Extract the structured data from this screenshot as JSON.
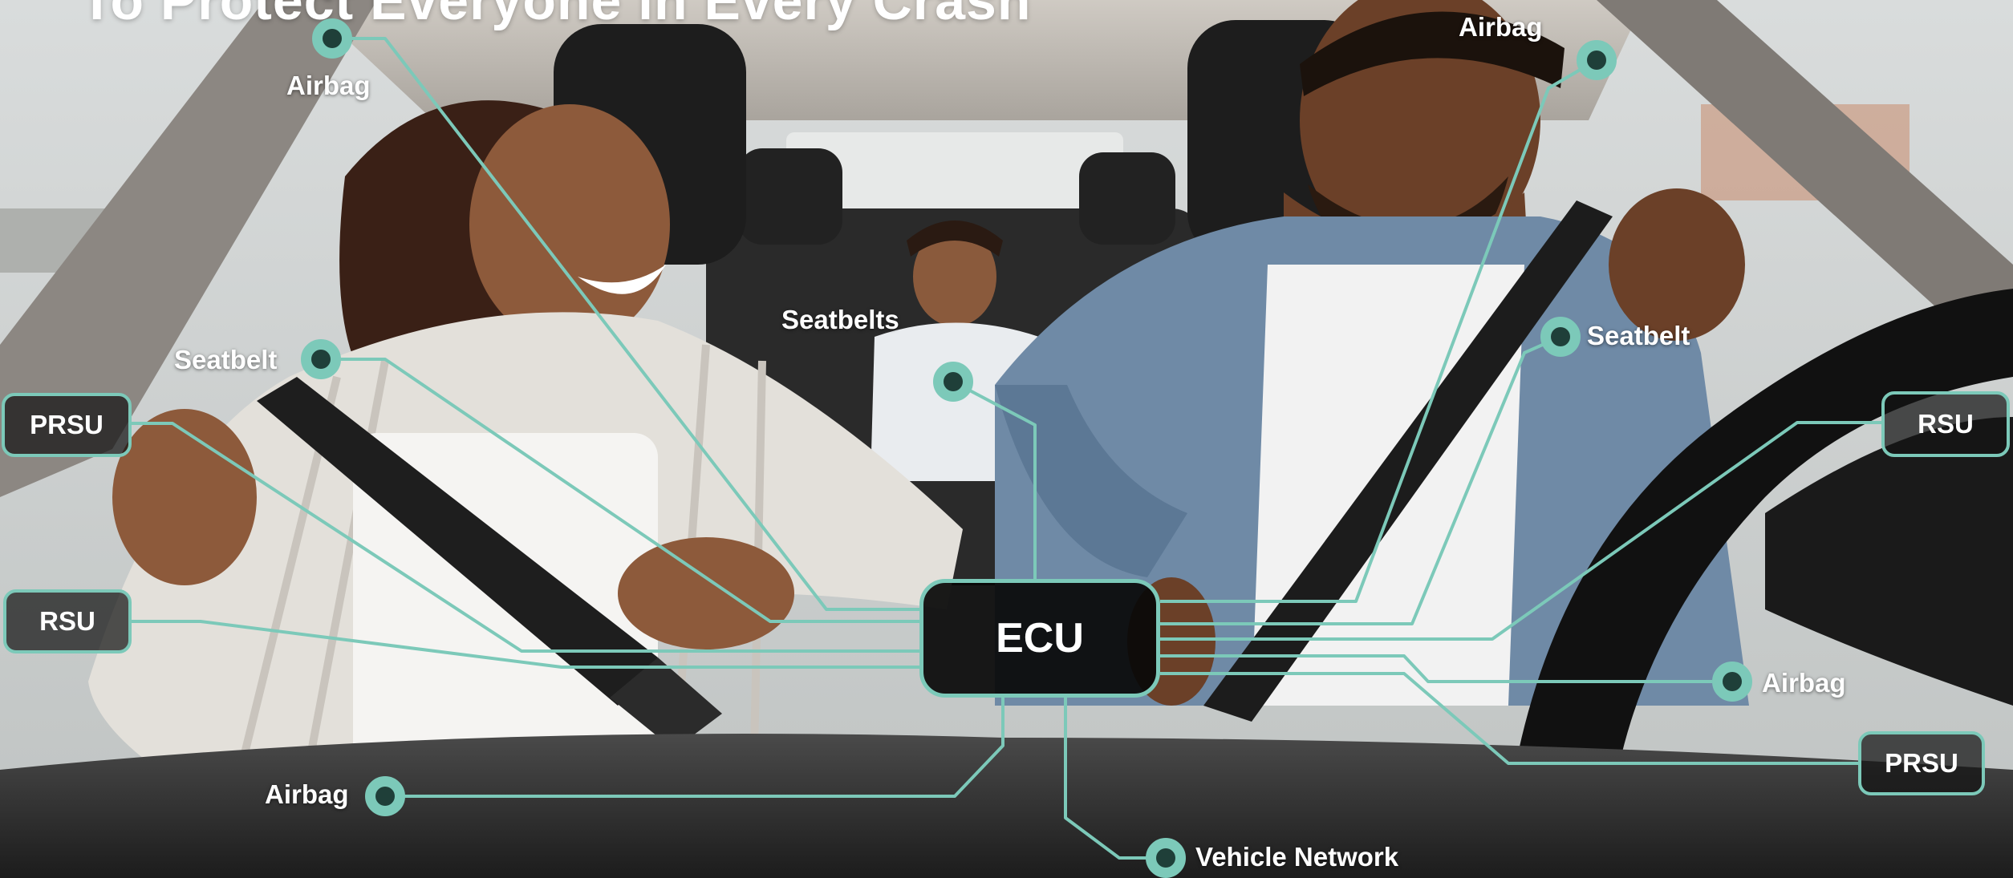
{
  "headline": "To Protect Everyone in Every Crash",
  "hub": "ECU",
  "labels": {
    "airbag_top_left": "Airbag",
    "airbag_top_right": "Airbag",
    "seatbelt_left": "Seatbelt",
    "seatbelts_rear": "Seatbelts",
    "seatbelt_right": "Seatbelt",
    "airbag_right": "Airbag",
    "airbag_bottom_left": "Airbag",
    "vehicle_network": "Vehicle Network"
  },
  "boxes": {
    "prsu_left": "PRSU",
    "rsu_left": "RSU",
    "rsu_right": "RSU",
    "prsu_right": "PRSU"
  },
  "colors": {
    "accent": "#7cc9b9",
    "hub_fill": "#0a0a0a",
    "label_text": "#ffffff"
  }
}
